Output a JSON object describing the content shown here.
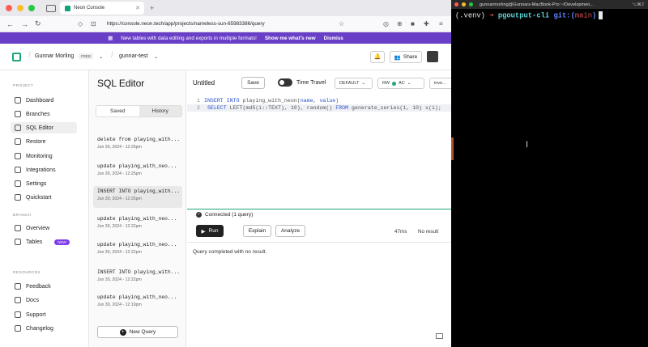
{
  "browser": {
    "tab_title": "Neon Console",
    "url": "https://console.neon.tech/app/projects/nameless-sun-65983386/query",
    "banner_text": "New tables with data editing and exports in multiple formats!",
    "banner_link": "Show me what's new",
    "banner_dismiss": "Dismiss"
  },
  "header": {
    "org": "Gunnar Morling",
    "plan_badge": "FREE",
    "project": "gunnar-test",
    "share_label": "Share"
  },
  "sidebar": {
    "project_label": "PROJECT",
    "project_items": [
      {
        "label": "Dashboard",
        "icon": "dashboard-icon"
      },
      {
        "label": "Branches",
        "icon": "branch-icon"
      },
      {
        "label": "SQL Editor",
        "icon": "sql-editor-icon"
      },
      {
        "label": "Restore",
        "icon": "restore-icon"
      },
      {
        "label": "Monitoring",
        "icon": "monitoring-icon"
      },
      {
        "label": "Integrations",
        "icon": "integrations-icon"
      },
      {
        "label": "Settings",
        "icon": "settings-icon"
      },
      {
        "label": "Quickstart",
        "icon": "quickstart-icon"
      }
    ],
    "branch_label": "BRANCH",
    "branch_items": [
      {
        "label": "Overview",
        "icon": "overview-icon"
      },
      {
        "label": "Tables",
        "icon": "tables-icon",
        "badge": "NEW"
      }
    ],
    "resources_label": "RESOURCES",
    "resource_items": [
      {
        "label": "Feedback",
        "icon": "feedback-icon"
      },
      {
        "label": "Docs",
        "icon": "docs-icon"
      },
      {
        "label": "Support",
        "icon": "support-icon"
      },
      {
        "label": "Changelog",
        "icon": "changelog-icon"
      }
    ]
  },
  "panel": {
    "title": "SQL Editor",
    "tab_saved": "Saved",
    "tab_history": "History",
    "queries": [
      {
        "text": "delete from playing_with...",
        "date": "Jun 30, 2024 - 12:26pm"
      },
      {
        "text": "update playing_with_neo...",
        "date": "Jun 30, 2024 - 12:25pm"
      },
      {
        "text": "INSERT INTO playing_with...",
        "date": "Jun 30, 2024 - 12:25pm"
      },
      {
        "text": "update playing_with_neo...",
        "date": "Jun 30, 2024 - 12:22pm"
      },
      {
        "text": "update playing_with_neo...",
        "date": "Jun 30, 2024 - 12:22pm"
      },
      {
        "text": "INSERT INTO playing_with...",
        "date": "Jun 30, 2024 - 12:22pm"
      },
      {
        "text": "update playing_with_neo...",
        "date": "Jun 30, 2024 - 12:19pm"
      }
    ],
    "new_query": "New Query"
  },
  "editor": {
    "title": "Untitled",
    "save": "Save",
    "time_travel": "Time Travel",
    "branch_select": "DEFAULT",
    "rw": "RW",
    "compute": "AC",
    "invite": "inve...",
    "code_lines": [
      {
        "num": "1",
        "kw1": "INSERT INTO",
        "rest": " playing_with_neon(",
        "a": "name",
        "b": ", ",
        "c": "value",
        "d": ")"
      },
      {
        "num": "2",
        "kw1": "  SELECT",
        "rest": " LEFT(md5(i::TEXT), 10), random() ",
        "kw2": "FROM",
        "tail": " generate_series(1, 10) s(i);"
      }
    ],
    "connected": "Connected (1 query)",
    "run": "Run",
    "explain": "Explain",
    "analyze": "Analyze",
    "timing": "47ms",
    "no_result": "No result",
    "result_msg": "Query completed with no result."
  },
  "terminal": {
    "title": "gunnarmorling@Gunnars-MacBook-Pro:~/Developmen...",
    "shortcut": "⌥⌘2",
    "venv": "(.venv)",
    "arrow": "➜",
    "dir": "pgoutput-cli",
    "git": "git:(",
    "branch": "main",
    "git_close": ")"
  }
}
